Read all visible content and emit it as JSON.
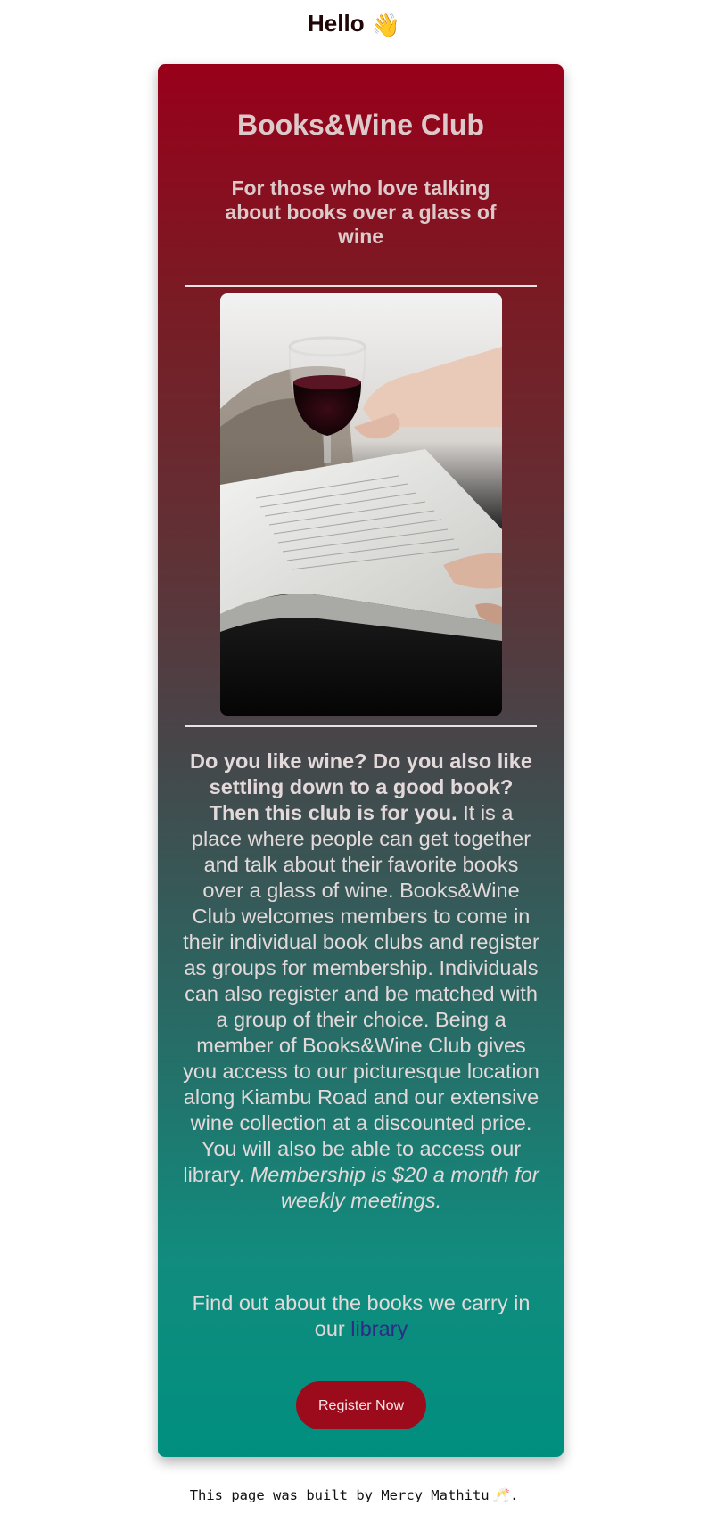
{
  "header": {
    "greeting": "Hello",
    "wave_icon": "👋"
  },
  "card": {
    "title": "Books&Wine Club",
    "subtitle": "For those who love talking about books over a glass of wine",
    "image_alt": "wine-glass-and-open-book",
    "lead": "Do you like wine? Do you also like settling down to a good book? Then this club is for you.",
    "description": "It is a place where people can get together and talk about their favorite books over a glass of wine. Books&Wine Club welcomes members to come in their individual book clubs and register as groups for membership. Individuals can also register and be matched with a group of their choice. Being a member of Books&Wine Club gives you access to our picturesque location along Kiambu Road and our extensive wine collection at a discounted price. You will also be able to access our library.",
    "price_note": "Membership is $20 a month for weekly meetings.",
    "library_prefix": "Find out about the books we carry in our",
    "library_link": "library",
    "register_label": "Register Now"
  },
  "footer": {
    "text": "This page was built by Mercy Mathitu",
    "toast_icon": "🥂",
    "suffix": "."
  },
  "colors": {
    "gradient_top": "#98001a",
    "gradient_bottom": "#008f7f",
    "button": "#9b0b1c",
    "link": "#2e2a86"
  }
}
